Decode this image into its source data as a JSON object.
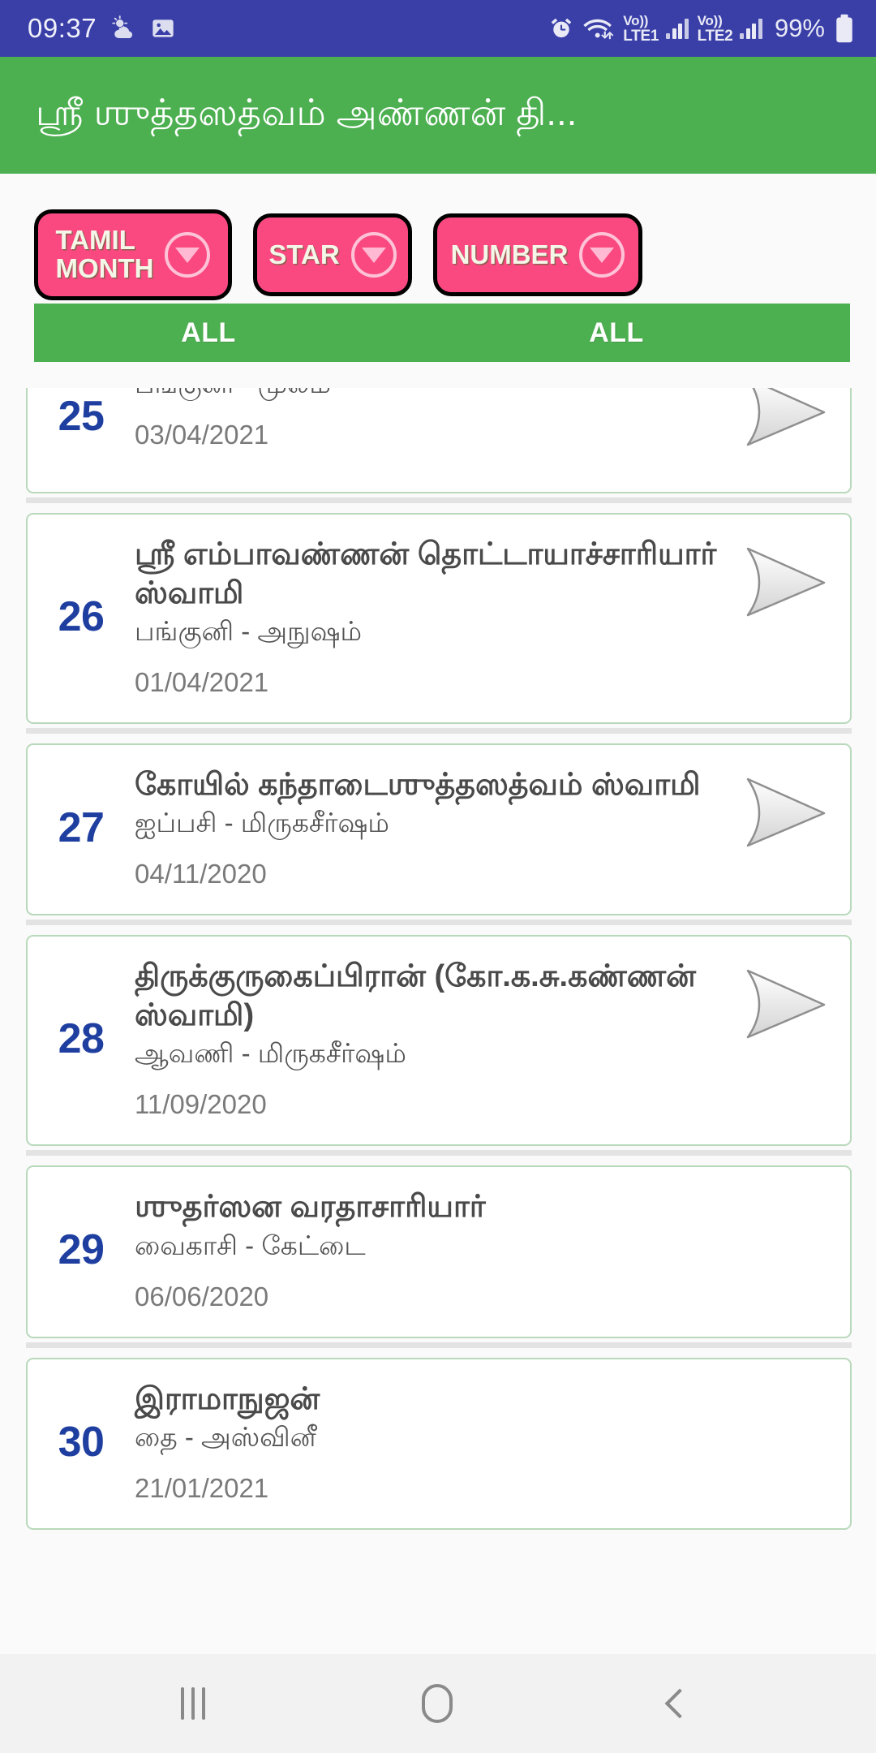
{
  "status_bar": {
    "time": "09:37",
    "left_icons": [
      "weather-icon",
      "image-icon"
    ],
    "right_icons": [
      "alarm-icon",
      "wifi-icon"
    ],
    "sim1_label_top": "Vo))",
    "sim1_label_bottom": "LTE1",
    "sim2_label_top": "Vo))",
    "sim2_label_bottom": "LTE2",
    "battery": "99%",
    "background_color": "#3a3fa8"
  },
  "header": {
    "title": "ஸ்ரீ ஶுத்தஸத்வம் அண்ணன் தி...",
    "background_color": "#4caf50"
  },
  "filters": {
    "background_color": "#fa4981",
    "items": [
      {
        "label": "TAMIL\nMONTH",
        "icon": "chevron-down-icon"
      },
      {
        "label": "STAR",
        "icon": "chevron-down-icon"
      },
      {
        "label": "NUMBER",
        "icon": "chevron-down-icon"
      }
    ]
  },
  "selection_bar": {
    "background_color": "#4caf50",
    "cells": [
      "ALL",
      "ALL"
    ]
  },
  "list": {
    "items": [
      {
        "number": "25",
        "title": "",
        "subtitle": "பங்குனி - மூலம்",
        "date": "03/04/2021",
        "arrow": "arrow-right-icon",
        "clipped": true
      },
      {
        "number": "26",
        "title": "ஸ்ரீ எம்பாவண்ணன் தொட்டாயாச்சாரியார் ஸ்வாமி",
        "subtitle": "பங்குனி - அநுஷம்",
        "date": "01/04/2021",
        "arrow": "arrow-right-icon"
      },
      {
        "number": "27",
        "title": "கோயில் கந்தாடைஶுத்தஸத்வம் ஸ்வாமி",
        "subtitle": "ஐப்பசி - மிருகசீர்ஷம்",
        "date": "04/11/2020",
        "arrow": "arrow-right-icon"
      },
      {
        "number": "28",
        "title": "திருக்குருகைப்பிரான் (கோ.க.சு.கண்ணன் ஸ்வாமி)",
        "subtitle": "ஆவணி - மிருகசீர்ஷம்",
        "date": "11/09/2020",
        "arrow": "arrow-right-icon"
      },
      {
        "number": "29",
        "title": "ஶுதர்ஸன வரதாசாரியார்",
        "subtitle": "வைகாசி - கேட்டை",
        "date": "06/06/2020",
        "arrow": ""
      },
      {
        "number": "30",
        "title": "இராமாநுஜன்",
        "subtitle": "தை - அஸ்வினீ",
        "date": "21/01/2021",
        "arrow": ""
      }
    ]
  },
  "nav_bar": {
    "items": [
      "recents-icon",
      "home-icon",
      "back-icon"
    ],
    "background_color": "#f2f2f2"
  }
}
